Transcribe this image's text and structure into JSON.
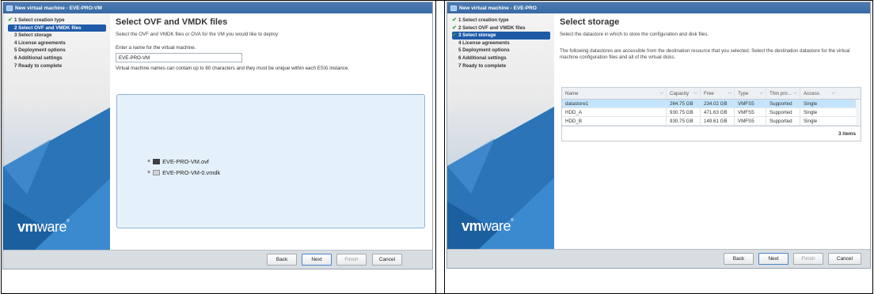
{
  "left": {
    "window_title": "New virtual machine - EVE-PRO-VM",
    "steps": [
      {
        "label": "1 Select creation type",
        "done": true
      },
      {
        "label": "2 Select OVF and VMDK files",
        "active": true
      },
      {
        "label": "3 Select storage"
      },
      {
        "label": "4 License agreements"
      },
      {
        "label": "5 Deployment options"
      },
      {
        "label": "6 Additional settings"
      },
      {
        "label": "7 Ready to complete"
      }
    ],
    "page_title": "Select OVF and VMDK files",
    "page_desc": "Select the OVF and VMDK files or OVA for the VM you would like to deploy",
    "name_label": "Enter a name for the virtual machine.",
    "name_value": "EVE-PRO-VM",
    "name_hint": "Virtual machine names can contain up to 80 characters and they must be unique within each ESXi instance.",
    "files": [
      {
        "remove": "×",
        "name": "EVE-PRO-VM.ovf",
        "icon": "ovf-file-icon"
      },
      {
        "remove": "×",
        "name": "EVE-PRO-VM-0.vmdk",
        "icon": "vmdk-file-icon"
      }
    ],
    "logo": {
      "pre": "vm",
      "post": "ware",
      "mark": "®"
    },
    "buttons": {
      "back": "Back",
      "next": "Next",
      "finish": "Finish",
      "cancel": "Cancel"
    }
  },
  "right": {
    "window_title": "New virtual machine - EVE-PRO",
    "steps": [
      {
        "label": "1 Select creation type",
        "done": true
      },
      {
        "label": "2 Select OVF and VMDK files",
        "done": true
      },
      {
        "label": "3 Select storage",
        "done": true,
        "active": true
      },
      {
        "label": "4 License agreements"
      },
      {
        "label": "5 Deployment options"
      },
      {
        "label": "6 Additional settings"
      },
      {
        "label": "7 Ready to complete"
      }
    ],
    "page_title": "Select storage",
    "page_desc": "Select the datastore in which to store the configuration and disk files.",
    "ds_desc": "The following datastores are accessible from the destination resource that you selected. Select the destination datastore for the virtual machine configuration files and all of the virtual disks.",
    "columns": [
      "Name",
      "Capacity",
      "Free",
      "Type",
      "Thin pro...",
      "Access"
    ],
    "rows": [
      {
        "name": "datastore1",
        "capacity": "264.75 GB",
        "free": "234.02 GB",
        "type": "VMFS5",
        "thin": "Supported",
        "access": "Single",
        "selected": true
      },
      {
        "name": "HDD_A",
        "capacity": "930.75 GB",
        "free": "471.63 GB",
        "type": "VMFS5",
        "thin": "Supported",
        "access": "Single"
      },
      {
        "name": "HDD_B",
        "capacity": "930.75 GB",
        "free": "149.61 GB",
        "type": "VMFS5",
        "thin": "Supported",
        "access": "Single"
      }
    ],
    "item_count": "3 items",
    "logo": {
      "pre": "vm",
      "post": "ware",
      "mark": "®"
    },
    "buttons": {
      "back": "Back",
      "next": "Next",
      "finish": "Finish",
      "cancel": "Cancel"
    }
  },
  "colors": {
    "accent": "#1e5aa8",
    "check": "#37a335",
    "selected_row": "#c4e4fb",
    "titlebar": "#3a6aa5"
  }
}
